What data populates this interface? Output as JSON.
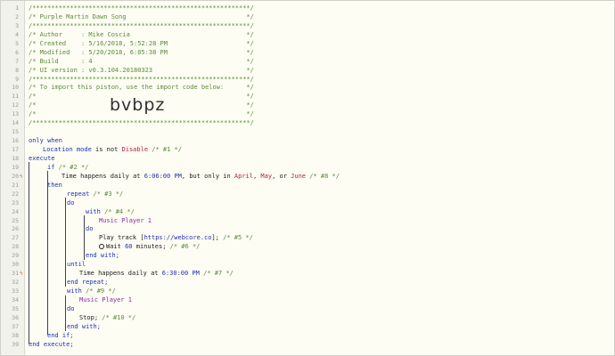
{
  "header": [
    "/**********************************************************/",
    "/* Purple Martin Dawn Song                                */",
    "/**********************************************************/",
    "/* Author     : Mike Coscia                               */",
    "/* Created    : 5/16/2018, 5:52:28 PM                     */",
    "/* Modified   : 5/20/2018, 6:05:38 PM                     */",
    "/* Build      : 4                                         */",
    "/* UI version : v0.3.104.20180323                         */",
    "/**********************************************************/",
    "/* To import this piston, use the import code below:      */",
    "/*                                                        */",
    "/*                                                        */",
    "/*                                                        */",
    "/**********************************************************/"
  ],
  "import_code": "bvbpz",
  "code": {
    "only_when": "only when",
    "location_mode": "Location mode",
    "is_not": "is not",
    "disable": "Disable",
    "c1": "/* #1 */",
    "execute": "execute",
    "if": "if",
    "c2": "/* #2 */",
    "time": "Time",
    "happens_daily_at": "happens daily at",
    "t1": "6:06:00 PM",
    "but_only_in": ", but only in",
    "april": "April",
    "comma": ",",
    "may": "May",
    "or": ", or",
    "june": "June",
    "c8": "/* #8 */",
    "then": "then",
    "repeat": "repeat",
    "c3": "/* #3 */",
    "do": "do",
    "with": "with",
    "c4": "/* #4 */",
    "music_player": "Music Player 1",
    "play_track": "Play track [",
    "url": "https://webcore.co",
    "play_track_end": "];",
    "c5": "/* #5 */",
    "wait": "Wait",
    "wait_num": "60",
    "minutes": "minutes;",
    "c6": "/* #6 */",
    "end_with": "end with;",
    "until": "until",
    "t2": "6:30:00 PM",
    "c7": "/* #7 */",
    "end_repeat": "end repeat;",
    "c9": "/* #9 */",
    "stop": "Stop;",
    "c10": "/* #10 */",
    "end_if": "end if;",
    "end_execute": "end execute;"
  },
  "line_numbers": [
    "1",
    "2",
    "3",
    "4",
    "5",
    "6",
    "7",
    "8",
    "9",
    "10",
    "11",
    "12",
    "13",
    "14",
    "15",
    "16",
    "17",
    "18",
    "19",
    "20",
    "21",
    "22",
    "23",
    "24",
    "25",
    "26",
    "27",
    "28",
    "29",
    "30",
    "31",
    "32",
    "33",
    "34",
    "35",
    "36",
    "37",
    "38",
    "39"
  ],
  "colors": {
    "background": "#fdfdf4",
    "comment": "#5a8a3a",
    "keyword": "#2030b0",
    "device": "#8a2aa8",
    "value": "#b02040"
  }
}
